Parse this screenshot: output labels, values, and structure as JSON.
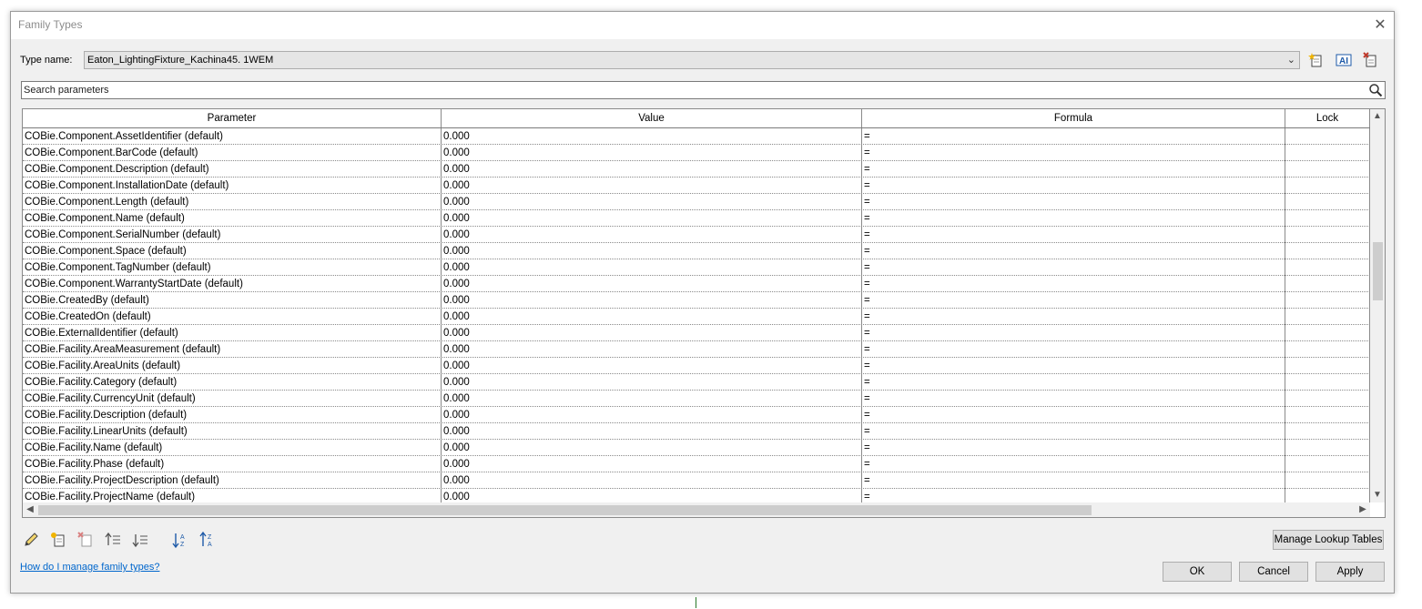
{
  "window": {
    "title": "Family Types",
    "close_glyph": "✕"
  },
  "type_name": {
    "label": "Type name:",
    "value": "Eaton_LightingFixture_Kachina45. 1WEM"
  },
  "search": {
    "placeholder": "Search parameters"
  },
  "table": {
    "headers": [
      "Parameter",
      "Value",
      "Formula",
      "Lock"
    ],
    "rows": [
      {
        "param": "COBie.Component.AssetIdentifier (default)",
        "value": "0.000",
        "formula": "="
      },
      {
        "param": "COBie.Component.BarCode (default)",
        "value": "0.000",
        "formula": "="
      },
      {
        "param": "COBie.Component.Description (default)",
        "value": "0.000",
        "formula": "="
      },
      {
        "param": "COBie.Component.InstallationDate (default)",
        "value": "0.000",
        "formula": "="
      },
      {
        "param": "COBie.Component.Length (default)",
        "value": "0.000",
        "formula": "="
      },
      {
        "param": "COBie.Component.Name (default)",
        "value": "0.000",
        "formula": "="
      },
      {
        "param": "COBie.Component.SerialNumber (default)",
        "value": "0.000",
        "formula": "="
      },
      {
        "param": "COBie.Component.Space (default)",
        "value": "0.000",
        "formula": "="
      },
      {
        "param": "COBie.Component.TagNumber (default)",
        "value": "0.000",
        "formula": "="
      },
      {
        "param": "COBie.Component.WarrantyStartDate (default)",
        "value": "0.000",
        "formula": "="
      },
      {
        "param": "COBie.CreatedBy (default)",
        "value": "0.000",
        "formula": "="
      },
      {
        "param": "COBie.CreatedOn (default)",
        "value": "0.000",
        "formula": "="
      },
      {
        "param": "COBie.ExternalIdentifier (default)",
        "value": "0.000",
        "formula": "="
      },
      {
        "param": "COBie.Facility.AreaMeasurement (default)",
        "value": "0.000",
        "formula": "="
      },
      {
        "param": "COBie.Facility.AreaUnits (default)",
        "value": "0.000",
        "formula": "="
      },
      {
        "param": "COBie.Facility.Category (default)",
        "value": "0.000",
        "formula": "="
      },
      {
        "param": "COBie.Facility.CurrencyUnit (default)",
        "value": "0.000",
        "formula": "="
      },
      {
        "param": "COBie.Facility.Description (default)",
        "value": "0.000",
        "formula": "="
      },
      {
        "param": "COBie.Facility.LinearUnits (default)",
        "value": "0.000",
        "formula": "="
      },
      {
        "param": "COBie.Facility.Name (default)",
        "value": "0.000",
        "formula": "="
      },
      {
        "param": "COBie.Facility.Phase (default)",
        "value": "0.000",
        "formula": "="
      },
      {
        "param": "COBie.Facility.ProjectDescription (default)",
        "value": "0.000",
        "formula": "="
      },
      {
        "param": "COBie.Facility.ProjectName (default)",
        "value": "0.000",
        "formula": "="
      }
    ]
  },
  "toolbar_icons": [
    "edit-pencil-icon",
    "new-parameter-icon",
    "delete-parameter-icon",
    "move-up-icon",
    "move-down-icon",
    "sort-ascending-icon",
    "sort-descending-icon"
  ],
  "buttons": {
    "manage_lookup": "Manage Lookup Tables",
    "ok": "OK",
    "cancel": "Cancel",
    "apply": "Apply"
  },
  "help_link": "How do I manage family types?",
  "colors": {
    "link": "#0066cc",
    "accent": "#1e5aa8",
    "delete": "#c0392b"
  }
}
